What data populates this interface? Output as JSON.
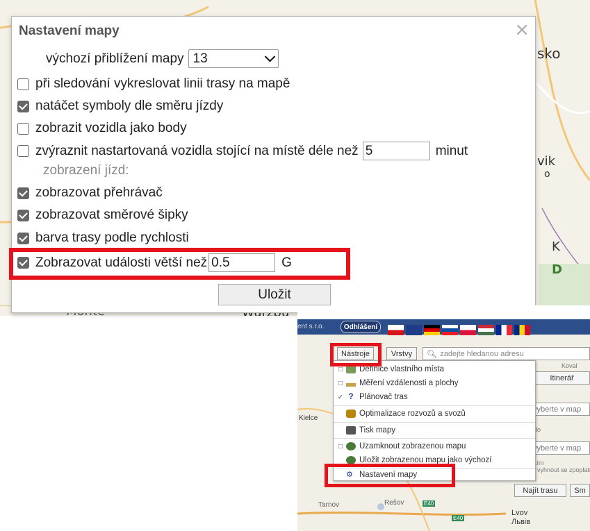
{
  "map": {
    "labels": {
      "wurzburg": "Würzbu",
      "monte": "Monte",
      "sko": "sko",
      "vik": "vik",
      "k": "K",
      "d": "D",
      "o1": "o",
      "o2": "o"
    }
  },
  "dialog": {
    "title": "Nastavení mapy",
    "close": "×",
    "zoom_label": "výchozí přiblížení mapy",
    "zoom_value": "13",
    "options": [
      {
        "label": "při sledování vykreslovat linii trasy na mapě",
        "checked": false
      },
      {
        "label": "natáčet symboly dle směru jízdy",
        "checked": true
      },
      {
        "label": "zobrazit vozidla jako body",
        "checked": false
      },
      {
        "label": "zvýraznit nastartovaná vozidla stojící na místě déle než",
        "checked": false
      }
    ],
    "idle_minutes_value": "5",
    "idle_minutes_unit": "minut",
    "rides_heading": "zobrazení jízd:",
    "ride_options": [
      {
        "label": "zobrazovat přehrávač",
        "checked": true
      },
      {
        "label": "zobrazovat směrové šipky",
        "checked": true
      },
      {
        "label": "barva trasy podle rychlosti",
        "checked": true
      }
    ],
    "events_label": "Zobrazovat události větší než",
    "events_checked": true,
    "events_value": "0.5",
    "events_unit": "G",
    "save_label": "Uložit"
  },
  "mini": {
    "company": "ent s.r.o.",
    "logout": "Odhlášení",
    "tools_tab": "Nástroje",
    "layers_tab": "Vrstvy",
    "search_placeholder": "zadejte hledanou adresu",
    "itinerary": "Itinerář",
    "pick_on_map_1": "vyberte v map",
    "pick_on_map_2": "vyberte v map",
    "find_route": "Najít trasu",
    "sm": "Sm",
    "kielce": "Kielce",
    "tarnow": "Tarnov",
    "rzeszow": "Rešov",
    "lvov": "Lvov",
    "lviv": "Львів",
    "e40": "E40",
    "e40b": "E40",
    "koval": "Koval",
    "do": "do",
    "cim": "cím",
    "useku": "vyhnout se zpoplatněným úseků",
    "menu": [
      {
        "mark": "□",
        "label": "Definice vlastního místa",
        "icon": "house-icon"
      },
      {
        "mark": "□",
        "label": "Měření vzdálenosti a plochy",
        "icon": "ruler-icon"
      },
      {
        "mark": "✓",
        "label": "Plánovač tras",
        "icon": "question-icon"
      },
      {
        "mark": "",
        "label": "Optimalizace rozvozů a svozů",
        "icon": "truck-icon"
      },
      {
        "mark": "",
        "label": "Tisk mapy",
        "icon": "printer-icon"
      },
      {
        "mark": "□",
        "label": "Uzamknout zobrazenou mapu",
        "icon": "lock-icon"
      },
      {
        "mark": "",
        "label": "Uložit zobrazenou mapu jako výchozí",
        "icon": "save-map-icon"
      },
      {
        "mark": "",
        "label": "Nastavení mapy",
        "icon": "settings-icon"
      }
    ]
  },
  "colors": {
    "highlight": "#e5141c",
    "checkbox": "#666666",
    "header_bar": "#2c4f8c"
  }
}
